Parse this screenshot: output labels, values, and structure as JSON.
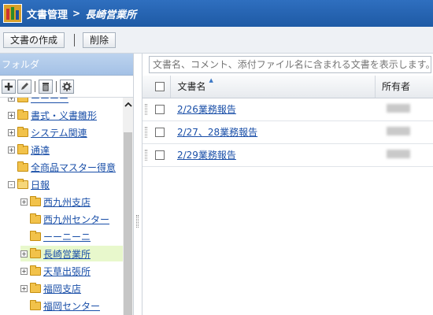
{
  "app": {
    "title": "文書管理",
    "separator": ">",
    "subtitle": "長崎営業所"
  },
  "toolbar": {
    "create_label": "文書の作成",
    "delete_label": "削除"
  },
  "folder_panel": {
    "header": "フォルダ",
    "tools": [
      "plus-icon",
      "pencil-icon",
      "trash-icon",
      "gear-icon"
    ],
    "tree": [
      {
        "label": "ーーーー",
        "expander": "+",
        "open": false
      },
      {
        "label": "書式・义書雛形",
        "expander": "+",
        "open": false
      },
      {
        "label": "システム関連",
        "expander": "+",
        "open": false
      },
      {
        "label": "通達",
        "expander": "+",
        "open": false
      },
      {
        "label": "全商品マスター得意",
        "expander": "",
        "open": false
      },
      {
        "label": "日報",
        "expander": "-",
        "open": true
      },
      {
        "label": "西九州支店",
        "expander": "+",
        "open": false
      },
      {
        "label": "西九州センター",
        "expander": "",
        "open": false
      },
      {
        "label": "ーーニーニ",
        "expander": "",
        "open": false
      },
      {
        "label": "長崎営業所",
        "expander": "+",
        "open": false,
        "selected": true
      },
      {
        "label": "天草出張所",
        "expander": "+",
        "open": false
      },
      {
        "label": "福岡支店",
        "expander": "+",
        "open": false
      },
      {
        "label": "福岡センター",
        "expander": "",
        "open": false
      }
    ]
  },
  "documents": {
    "search_placeholder": "文書名、コメント、添付ファイル名に含まれる文書を表示します。",
    "columns": {
      "name": "文書名",
      "owner": "所有者"
    },
    "rows": [
      {
        "name": "2/26業務報告"
      },
      {
        "name": "2/27、28業務報告"
      },
      {
        "name": "2/29業務報告"
      }
    ]
  },
  "colors": {
    "titlebar": "#1e5aa5",
    "folder_header": "#a4c1e6",
    "selected_row": "#e8f8cc",
    "link": "#1a4fa8"
  }
}
